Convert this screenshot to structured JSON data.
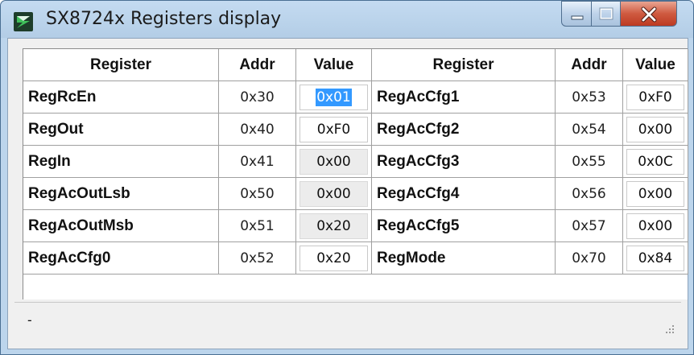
{
  "window": {
    "title": "SX8724x Registers display"
  },
  "controls": [
    "minimize-icon",
    "maximize-icon",
    "close-icon"
  ],
  "table": {
    "headers": [
      "Register",
      "Addr",
      "Value",
      "Register",
      "Addr",
      "Value"
    ],
    "rows": [
      {
        "left": {
          "name": "RegRcEn",
          "addr": "0x30",
          "value": "0x01",
          "editable": true,
          "selected": true
        },
        "right": {
          "name": "RegAcCfg1",
          "addr": "0x53",
          "value": "0xF0",
          "editable": true
        }
      },
      {
        "left": {
          "name": "RegOut",
          "addr": "0x40",
          "value": "0xF0",
          "editable": true
        },
        "right": {
          "name": "RegAcCfg2",
          "addr": "0x54",
          "value": "0x00",
          "editable": true
        }
      },
      {
        "left": {
          "name": "RegIn",
          "addr": "0x41",
          "value": "0x00",
          "editable": false
        },
        "right": {
          "name": "RegAcCfg3",
          "addr": "0x55",
          "value": "0x0C",
          "editable": true
        }
      },
      {
        "left": {
          "name": "RegAcOutLsb",
          "addr": "0x50",
          "value": "0x00",
          "editable": false
        },
        "right": {
          "name": "RegAcCfg4",
          "addr": "0x56",
          "value": "0x00",
          "editable": true
        }
      },
      {
        "left": {
          "name": "RegAcOutMsb",
          "addr": "0x51",
          "value": "0x20",
          "editable": false
        },
        "right": {
          "name": "RegAcCfg5",
          "addr": "0x57",
          "value": "0x00",
          "editable": true
        }
      },
      {
        "left": {
          "name": "RegAcCfg0",
          "addr": "0x52",
          "value": "0x20",
          "editable": true
        },
        "right": {
          "name": "RegMode",
          "addr": "0x70",
          "value": "0x84",
          "editable": true
        }
      }
    ]
  },
  "status_bar": {
    "text": "-"
  },
  "colors": {
    "selection": "#3399ff",
    "title_bar": "#bcd5ec",
    "close_button": "#cf5a40"
  }
}
